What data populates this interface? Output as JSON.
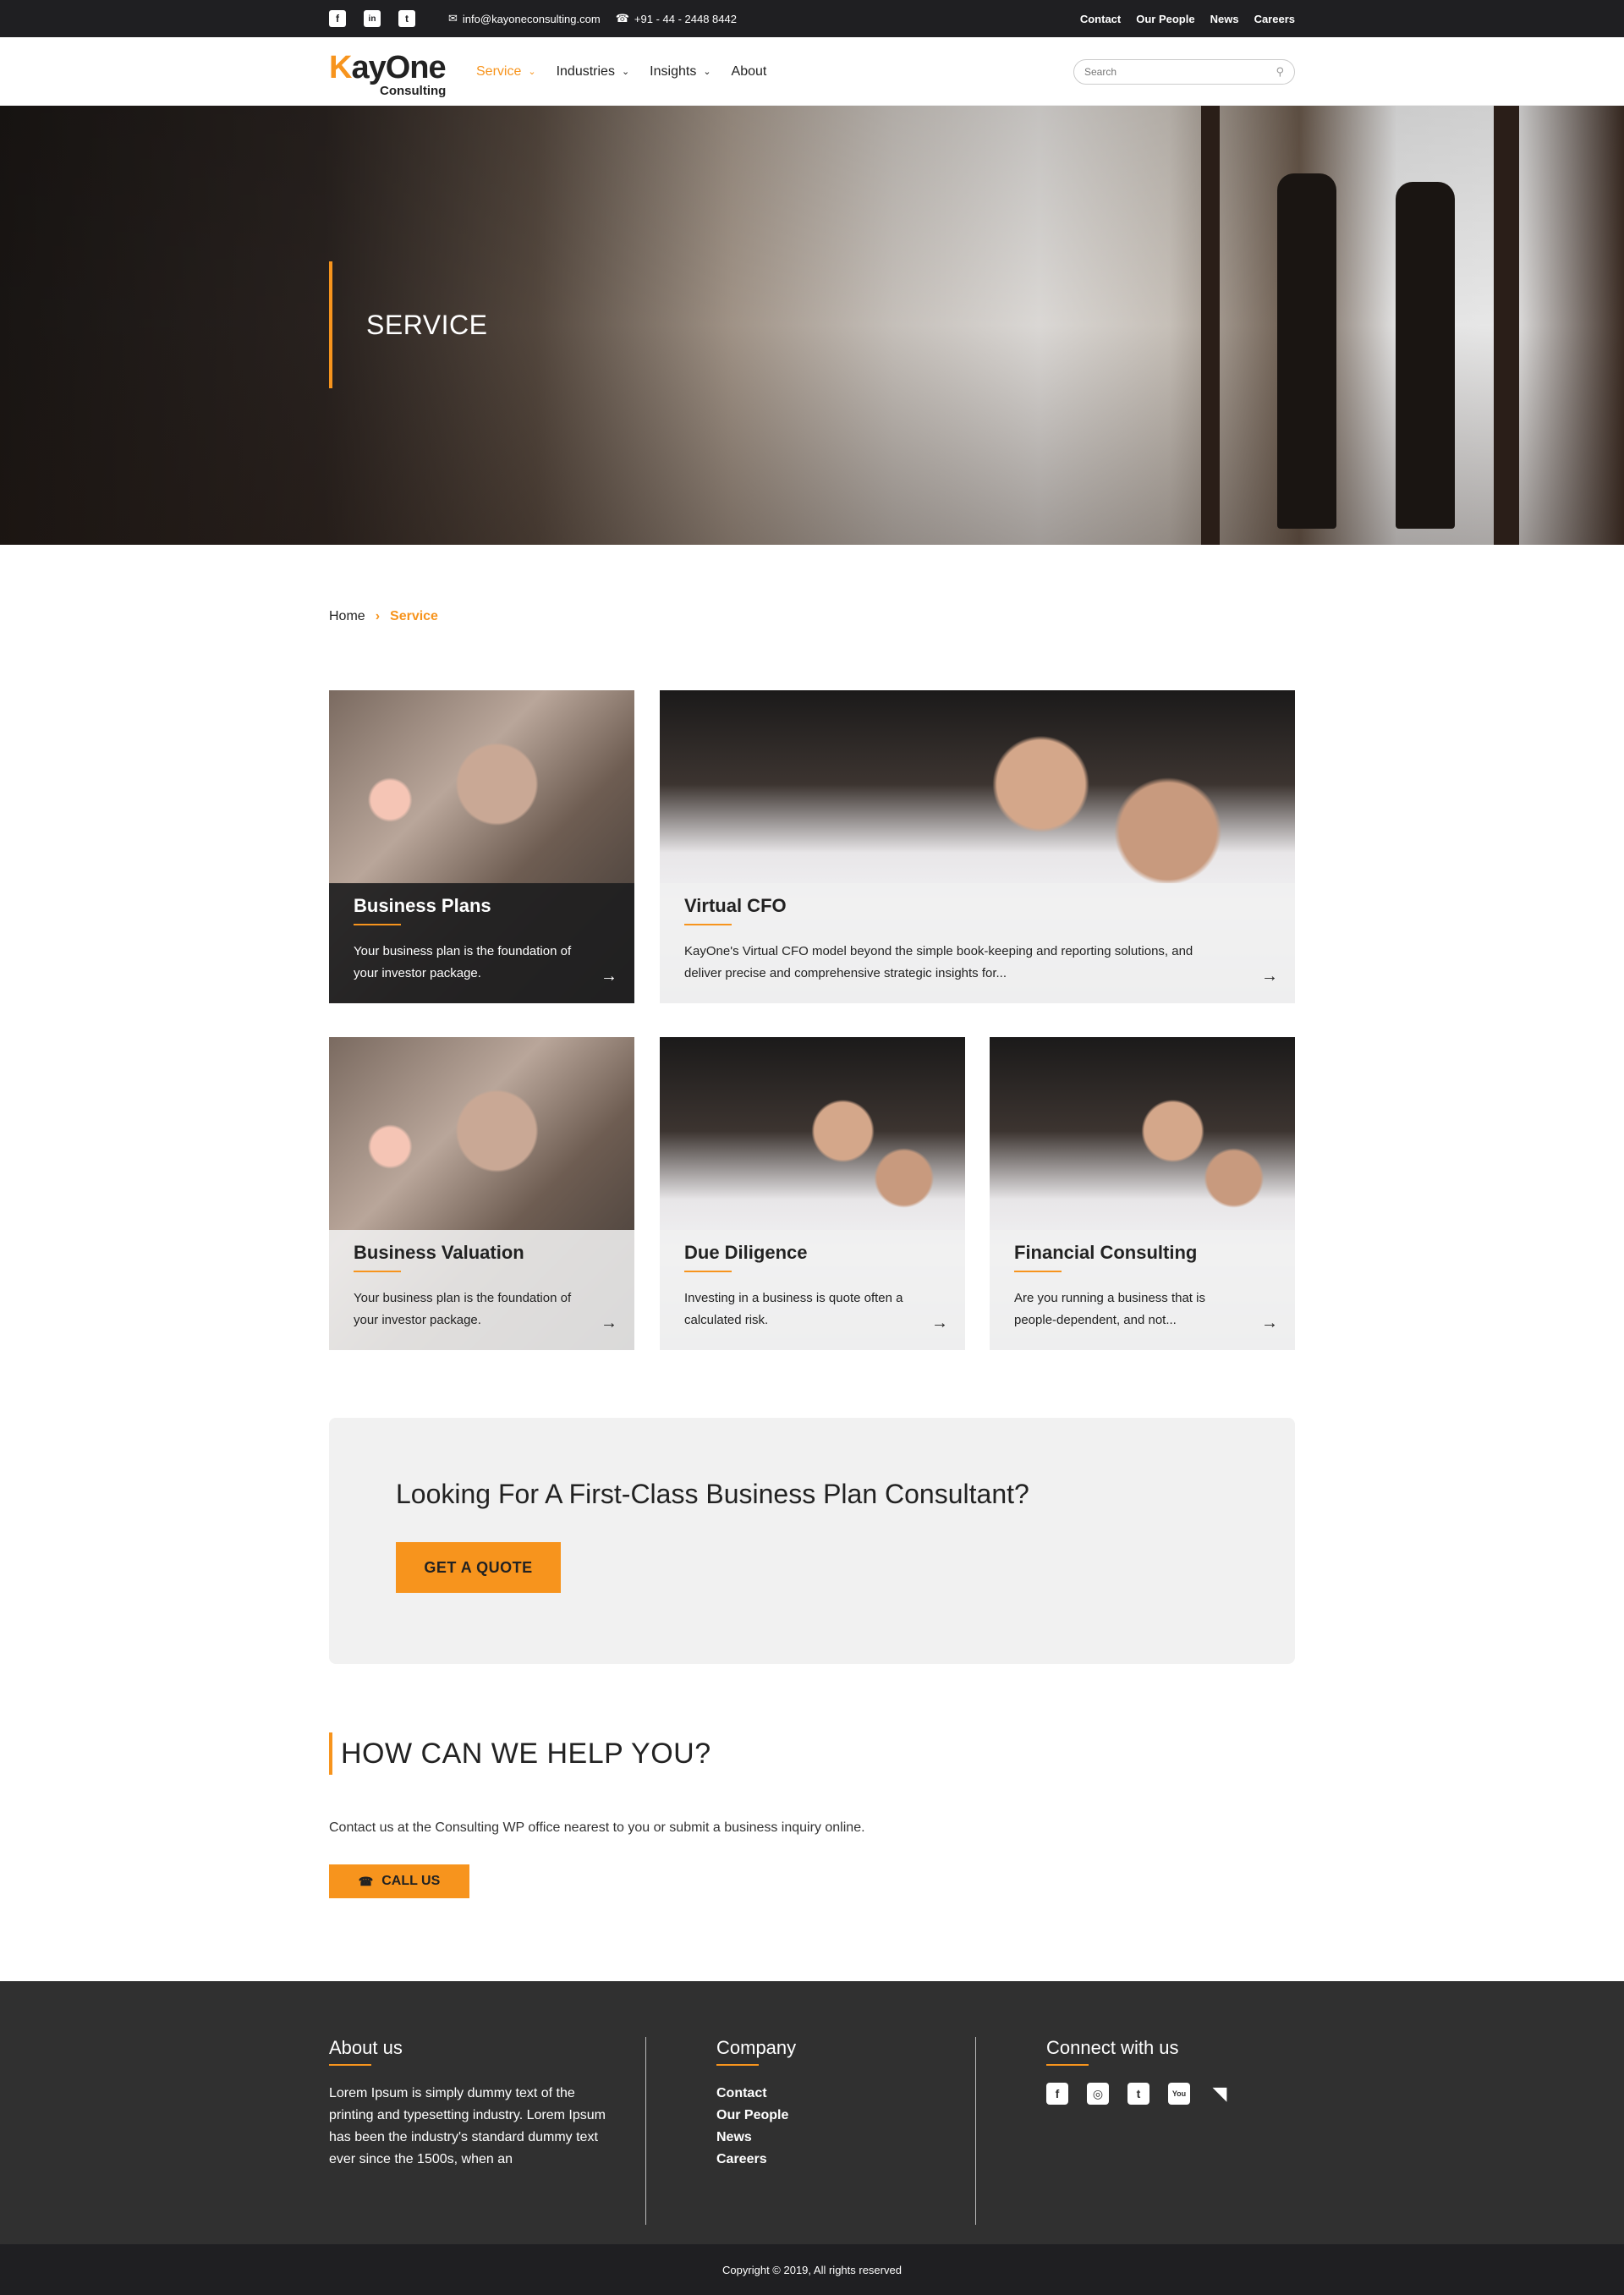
{
  "topbar": {
    "social": [
      {
        "name": "facebook-icon",
        "glyph": "f"
      },
      {
        "name": "linkedin-icon",
        "glyph": "in"
      },
      {
        "name": "twitter-icon",
        "glyph": "t"
      }
    ],
    "email": "info@kayoneconsulting.com",
    "phone": "+91 - 44 - 2448 8442",
    "links": [
      "Contact",
      "Our People",
      "News",
      "Careers"
    ]
  },
  "nav": {
    "logo_main_k": "K",
    "logo_main_rest": "ayOne",
    "logo_sub": "Consulting",
    "items": [
      {
        "label": "Service",
        "active": true,
        "has_dropdown": true
      },
      {
        "label": "Industries",
        "active": false,
        "has_dropdown": true
      },
      {
        "label": "Insights",
        "active": false,
        "has_dropdown": true
      },
      {
        "label": "About",
        "active": false,
        "has_dropdown": false
      }
    ],
    "search_placeholder": "Search"
  },
  "hero": {
    "title": "SERVICE"
  },
  "breadcrumb": {
    "home": "Home",
    "current": "Service"
  },
  "cards": [
    {
      "title": "Business Plans",
      "text": "Your business plan is the foundation of your investor package."
    },
    {
      "title": "Virtual CFO",
      "text": "KayOne's Virtual CFO model beyond the simple book-keeping and reporting solutions, and deliver precise and comprehensive strategic insights for..."
    },
    {
      "title": "Business Valuation",
      "text": "Your business plan is the foundation of your investor package."
    },
    {
      "title": "Due Diligence",
      "text": "Investing in a business is quote often a calculated risk."
    },
    {
      "title": "Financial Consulting",
      "text": "Are you running a business that is people-dependent, and not..."
    }
  ],
  "quote": {
    "heading": "Looking For A First-Class Business Plan Consultant?",
    "button": "GET A QUOTE"
  },
  "help": {
    "heading": "HOW CAN WE HELP YOU?",
    "text": "Contact us at the Consulting WP office nearest to you or submit a business inquiry online.",
    "button": "CALL US"
  },
  "footer": {
    "about_title": "About us",
    "about_text": "Lorem Ipsum is simply dummy text of the printing and typesetting industry. Lorem Ipsum has been the industry's standard dummy text ever since the 1500s, when an",
    "company_title": "Company",
    "company_links": [
      "Contact",
      "Our People",
      "News",
      "Careers"
    ],
    "connect_title": "Connect with us",
    "social": [
      "facebook-icon",
      "instagram-icon",
      "twitter-icon",
      "youtube-icon",
      "rss-icon"
    ],
    "copyright": "Copyright © 2019, All rights reserved"
  },
  "colors": {
    "accent": "#f7941d",
    "dark": "#1f1f22",
    "footer": "#303030"
  }
}
